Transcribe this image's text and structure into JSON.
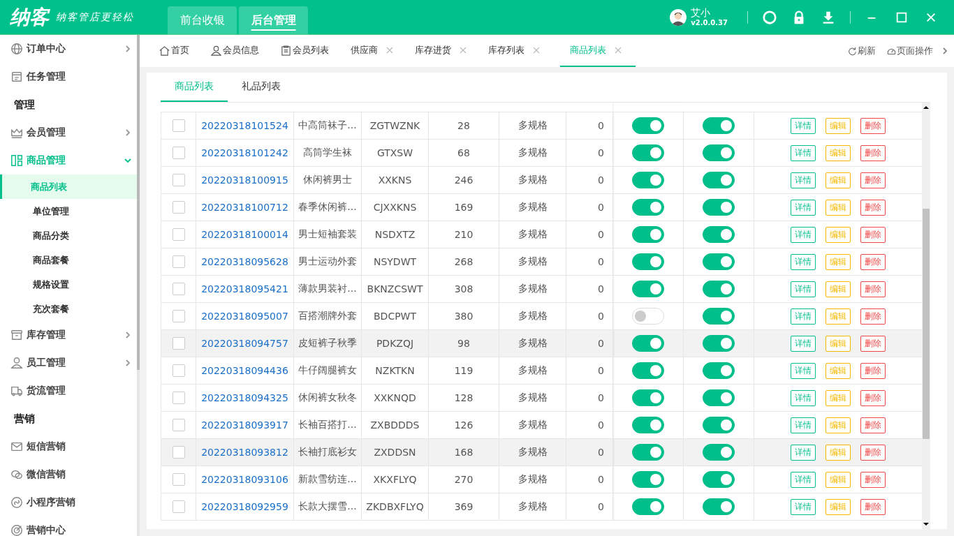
{
  "app": {
    "logo": "纳客",
    "slogan": "纳客管店更轻松"
  },
  "top_tabs": [
    {
      "label": "前台收银",
      "selected": false
    },
    {
      "label": "后台管理",
      "selected": true
    }
  ],
  "user": {
    "name": "艾小",
    "version": "v2.0.0.37"
  },
  "sidebar": {
    "items": [
      {
        "kind": "item",
        "label": "订单中心",
        "expanded": false
      },
      {
        "kind": "item",
        "label": "任务管理"
      },
      {
        "kind": "section",
        "label": "管理"
      },
      {
        "kind": "item",
        "label": "会员管理",
        "expanded": false
      },
      {
        "kind": "item",
        "label": "商品管理",
        "expanded": true,
        "children": [
          {
            "label": "商品列表",
            "selected": true
          },
          {
            "label": "单位管理",
            "selected": false
          },
          {
            "label": "商品分类",
            "selected": false
          },
          {
            "label": "商品套餐",
            "selected": false
          },
          {
            "label": "规格设置",
            "selected": false
          },
          {
            "label": "充次套餐",
            "selected": false
          }
        ]
      },
      {
        "kind": "item",
        "label": "库存管理",
        "expanded": false
      },
      {
        "kind": "item",
        "label": "员工管理",
        "expanded": false
      },
      {
        "kind": "item",
        "label": "货流管理"
      },
      {
        "kind": "section",
        "label": "营销"
      },
      {
        "kind": "item",
        "label": "短信营销"
      },
      {
        "kind": "item",
        "label": "微信营销"
      },
      {
        "kind": "item",
        "label": "小程序营销"
      },
      {
        "kind": "item",
        "label": "营销中心"
      }
    ]
  },
  "page_tabs": [
    {
      "label": "首页",
      "closable": false,
      "selected": false
    },
    {
      "label": "会员信息",
      "closable": false,
      "selected": false
    },
    {
      "label": "会员列表",
      "closable": false,
      "selected": false
    },
    {
      "label": "供应商",
      "closable": true,
      "selected": false
    },
    {
      "label": "库存进货",
      "closable": true,
      "selected": false
    },
    {
      "label": "库存列表",
      "closable": true,
      "selected": false
    },
    {
      "label": "商品列表",
      "closable": true,
      "selected": true
    }
  ],
  "page_actions": [
    {
      "label": "刷新"
    },
    {
      "label": "页面操作"
    }
  ],
  "sub_tabs": [
    {
      "label": "商品列表",
      "selected": true
    },
    {
      "label": "礼品列表",
      "selected": false
    }
  ],
  "table": {
    "rows": [
      {
        "number": "20220318101524",
        "name": "中高筒袜子...",
        "code": "ZGTWZNK",
        "column_4": "28",
        "column_5": "多规格",
        "column_6": "0",
        "switch_1": true,
        "switch_2": true,
        "highlighted": false,
        "actions": [
          {
            "kind": "detail",
            "label": "详情"
          },
          {
            "kind": "edit",
            "label": "编辑"
          },
          {
            "kind": "delete",
            "label": "删除"
          }
        ]
      },
      {
        "number": "20220318101242",
        "name": "高筒学生袜",
        "code": "GTXSW",
        "column_4": "68",
        "column_5": "多规格",
        "column_6": "0",
        "switch_1": true,
        "switch_2": true,
        "highlighted": false,
        "actions": [
          {
            "kind": "detail",
            "label": "详情"
          },
          {
            "kind": "edit",
            "label": "编辑"
          },
          {
            "kind": "delete",
            "label": "删除"
          }
        ]
      },
      {
        "number": "20220318100915",
        "name": "休闲裤男士",
        "code": "XXKNS",
        "column_4": "246",
        "column_5": "多规格",
        "column_6": "0",
        "switch_1": true,
        "switch_2": true,
        "highlighted": false,
        "actions": [
          {
            "kind": "detail",
            "label": "详情"
          },
          {
            "kind": "edit",
            "label": "编辑"
          },
          {
            "kind": "delete",
            "label": "删除"
          }
        ]
      },
      {
        "number": "20220318100712",
        "name": "春季休闲裤...",
        "code": "CJXXKNS",
        "column_4": "169",
        "column_5": "多规格",
        "column_6": "0",
        "switch_1": true,
        "switch_2": true,
        "highlighted": false,
        "actions": [
          {
            "kind": "detail",
            "label": "详情"
          },
          {
            "kind": "edit",
            "label": "编辑"
          },
          {
            "kind": "delete",
            "label": "删除"
          }
        ]
      },
      {
        "number": "20220318100014",
        "name": "男士短袖套装",
        "code": "NSDXTZ",
        "column_4": "210",
        "column_5": "多规格",
        "column_6": "0",
        "switch_1": true,
        "switch_2": true,
        "highlighted": false,
        "actions": [
          {
            "kind": "detail",
            "label": "详情"
          },
          {
            "kind": "edit",
            "label": "编辑"
          },
          {
            "kind": "delete",
            "label": "删除"
          }
        ]
      },
      {
        "number": "20220318095628",
        "name": "男士运动外套",
        "code": "NSYDWT",
        "column_4": "268",
        "column_5": "多规格",
        "column_6": "0",
        "switch_1": true,
        "switch_2": true,
        "highlighted": false,
        "actions": [
          {
            "kind": "detail",
            "label": "详情"
          },
          {
            "kind": "edit",
            "label": "编辑"
          },
          {
            "kind": "delete",
            "label": "删除"
          }
        ]
      },
      {
        "number": "20220318095421",
        "name": "薄款男装衬...",
        "code": "BKNZCSWT",
        "column_4": "308",
        "column_5": "多规格",
        "column_6": "0",
        "switch_1": true,
        "switch_2": true,
        "highlighted": false,
        "actions": [
          {
            "kind": "detail",
            "label": "详情"
          },
          {
            "kind": "edit",
            "label": "编辑"
          },
          {
            "kind": "delete",
            "label": "删除"
          }
        ]
      },
      {
        "number": "20220318095007",
        "name": "百搭潮牌外套",
        "code": "BDCPWT",
        "column_4": "380",
        "column_5": "多规格",
        "column_6": "0",
        "switch_1": false,
        "switch_2": true,
        "highlighted": false,
        "actions": [
          {
            "kind": "detail",
            "label": "详情"
          },
          {
            "kind": "edit",
            "label": "编辑"
          },
          {
            "kind": "delete",
            "label": "删除"
          }
        ]
      },
      {
        "number": "20220318094757",
        "name": "皮短裤子秋季",
        "code": "PDKZQJ",
        "column_4": "98",
        "column_5": "多规格",
        "column_6": "0",
        "switch_1": true,
        "switch_2": true,
        "highlighted": true,
        "actions": [
          {
            "kind": "detail",
            "label": "详情"
          },
          {
            "kind": "edit",
            "label": "编辑"
          },
          {
            "kind": "delete",
            "label": "删除"
          }
        ]
      },
      {
        "number": "20220318094436",
        "name": "牛仔阔腿裤女",
        "code": "NZKTKN",
        "column_4": "119",
        "column_5": "多规格",
        "column_6": "0",
        "switch_1": true,
        "switch_2": true,
        "highlighted": false,
        "actions": [
          {
            "kind": "detail",
            "label": "详情"
          },
          {
            "kind": "edit",
            "label": "编辑"
          },
          {
            "kind": "delete",
            "label": "删除"
          }
        ]
      },
      {
        "number": "20220318094325",
        "name": "休闲裤女秋冬",
        "code": "XXKNQD",
        "column_4": "128",
        "column_5": "多规格",
        "column_6": "0",
        "switch_1": true,
        "switch_2": true,
        "highlighted": false,
        "actions": [
          {
            "kind": "detail",
            "label": "详情"
          },
          {
            "kind": "edit",
            "label": "编辑"
          },
          {
            "kind": "delete",
            "label": "删除"
          }
        ]
      },
      {
        "number": "20220318093917",
        "name": "长袖百搭打...",
        "code": "ZXBDDDS",
        "column_4": "126",
        "column_5": "多规格",
        "column_6": "0",
        "switch_1": true,
        "switch_2": true,
        "highlighted": false,
        "actions": [
          {
            "kind": "detail",
            "label": "详情"
          },
          {
            "kind": "edit",
            "label": "编辑"
          },
          {
            "kind": "delete",
            "label": "删除"
          }
        ]
      },
      {
        "number": "20220318093812",
        "name": "长袖打底衫女",
        "code": "ZXDDSN",
        "column_4": "168",
        "column_5": "多规格",
        "column_6": "0",
        "switch_1": true,
        "switch_2": true,
        "highlighted": true,
        "actions": [
          {
            "kind": "detail",
            "label": "详情"
          },
          {
            "kind": "edit",
            "label": "编辑"
          },
          {
            "kind": "delete",
            "label": "删除"
          }
        ]
      },
      {
        "number": "20220318093106",
        "name": "新款雪纺连...",
        "code": "XKXFLYQ",
        "column_4": "270",
        "column_5": "多规格",
        "column_6": "0",
        "switch_1": true,
        "switch_2": true,
        "highlighted": false,
        "actions": [
          {
            "kind": "detail",
            "label": "详情"
          },
          {
            "kind": "edit",
            "label": "编辑"
          },
          {
            "kind": "delete",
            "label": "删除"
          }
        ]
      },
      {
        "number": "20220318092959",
        "name": "长款大摆雪...",
        "code": "ZKDBXFLYQ",
        "column_4": "369",
        "column_5": "多规格",
        "column_6": "0",
        "switch_1": true,
        "switch_2": true,
        "highlighted": false,
        "actions": [
          {
            "kind": "detail",
            "label": "详情"
          },
          {
            "kind": "edit",
            "label": "编辑"
          },
          {
            "kind": "delete",
            "label": "删除"
          }
        ]
      }
    ]
  }
}
